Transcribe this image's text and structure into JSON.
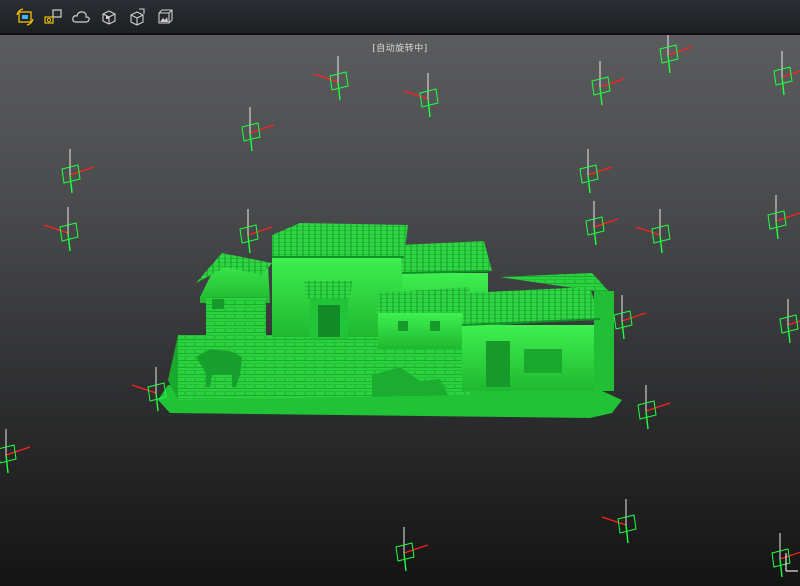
{
  "toolbar": {
    "tools": [
      {
        "name": "auto-rotate-tool-icon"
      },
      {
        "name": "capture-camera-tool-icon"
      },
      {
        "name": "cloud-tool-icon"
      },
      {
        "name": "view-cube-tool-icon"
      },
      {
        "name": "transform-cube-tool-icon"
      },
      {
        "name": "texture-image-tool-icon"
      }
    ],
    "accent": "#f0c000"
  },
  "viewport": {
    "status_label": "[自动旋转中]"
  },
  "colors": {
    "model_green": "#28d23c",
    "axis_x": "#ff2020",
    "axis_y": "#20ff40",
    "axis_z": "#e8e8e8"
  }
}
